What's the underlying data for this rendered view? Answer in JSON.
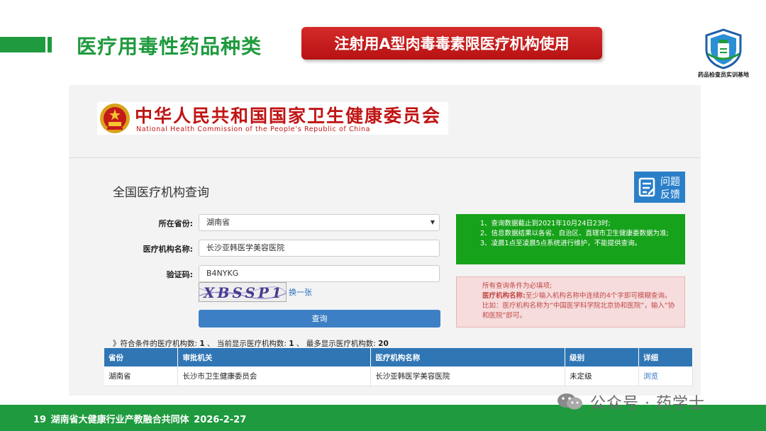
{
  "slide": {
    "title": "医疗用毒性药品种类",
    "banner": "注射用A型肉毒毒素限医疗机构使用",
    "logo_caption": "药品检查员实训基地",
    "footer": "19   湖南省大健康行业产教融合共同体   2026-2-27",
    "watermark": "公众号 · 药学士",
    "colors": {
      "brand_green": "#1f9a3e",
      "banner_red": "#c81e1e",
      "table_header_blue": "#3076b4"
    }
  },
  "site": {
    "org_name_cn": "中华人民共和国国家卫生健康委员会",
    "org_name_en": "National Health Commission of the People’s Republic of China",
    "form_title": "全国医疗机构查询",
    "feedback_line1": "问题",
    "feedback_line2": "反馈",
    "fields": {
      "province_label": "所在省份:",
      "province_value": "湖南省",
      "name_label": "医疗机构名称:",
      "name_value": "长沙亚韩医学美容医院",
      "captcha_label": "验证码:",
      "captcha_value": "B4NYKG",
      "captcha_image_text": "XBSSP1",
      "refresh_link": "换一张"
    },
    "query_button": "查询",
    "green_notice": [
      "1、查询数据截止到2021年10月24日23时;",
      "2、信息数据结果以各省、自治区、直辖市卫生健康委数据为准;",
      "3、凌晨1点至凌晨5点系统进行维护，不能提供查询。"
    ],
    "pink_notice": {
      "line1": "所有查询条件为必填项;",
      "bold_label": "医疗机构名称:",
      "rest": "至少输入机构名称中连续的4个字即可模糊查询。比如：医疗机构名称为“中国医学科学院北京协和医院”，输入“协和医院”即可。"
    },
    "summary": {
      "prefix": "》符合条件的医疗机构数:",
      "count": "1",
      "mid": "、 当前显示医疗机构数:",
      "shown": "1",
      "mid2": "、 最多显示医疗机构数:",
      "max": "20"
    },
    "table": {
      "headers": [
        "省份",
        "审批机关",
        "医疗机构名称",
        "级别",
        "详细"
      ],
      "rows": [
        [
          "湖南省",
          "长沙市卫生健康委员会",
          "长沙亚韩医学美容医院",
          "未定级",
          "浏览"
        ]
      ]
    }
  }
}
